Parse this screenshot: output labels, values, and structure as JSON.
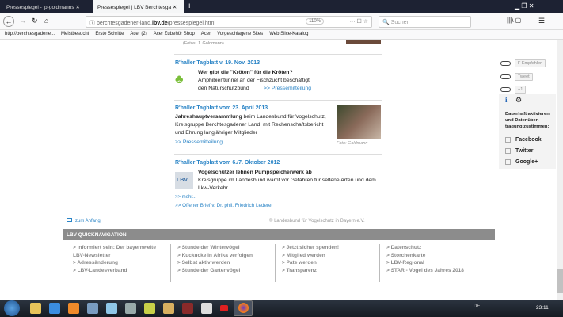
{
  "browser": {
    "tabs": [
      {
        "label": "Pressespiegel - jp-goldmanns"
      },
      {
        "label": "Pressespiegel | LBV Berchtesga"
      }
    ],
    "new_tab": "+",
    "url_domain": "berchtesgadener-land.",
    "url_bold": "lbv.de",
    "url_path": "/pressespiegel.html",
    "zoom": "110%",
    "search_placeholder": "Suchen",
    "bookmarks": [
      "http://berchtesgadene...",
      "Meistbesucht",
      "Erste Schritte",
      "Acer (2)",
      "Acer Zubehör Shop",
      "Acer",
      "Vorgeschlagene Sites",
      "Web Slice-Katalog"
    ]
  },
  "content": {
    "photo_credit_top": "(Fotos: J. Goldmann)",
    "articles": [
      {
        "source": "R'haller Tagblatt v. 19. Nov. 2013",
        "title": "Wer gibt die \"Kröten\" für die Kröten?",
        "text": "Amphibientunnel an der Fischzucht beschäftigt",
        "text2": "den Naturschutzbund",
        "link": ">> Pressemitteilung"
      },
      {
        "source": "R'haller Tagblatt vom 23. April 2013",
        "title": "Jahreshauptversammlung",
        "text": " beim Landesbund für Vogelschutz, Kreisgruppe Berchtesgadener Land, mit Rechenschaftsbericht und Ehrung langjähriger Mitglieder",
        "link": ">> Pressemitteilung",
        "photo_credit": "Foto: Goldmann"
      },
      {
        "source": "R'haller Tagblatt vom 6./7. Oktober 2012",
        "title": "Vogelschützer lehnen Pumpspeicherwerk ab",
        "text": "Kreisgruppe im Landesbund warnt vor Gefahren für seltene Arten und dem Lkw-Verkehr",
        "link": ">> mehr...",
        "link2": ">> Offener Brief v. Dr. phil. Friedrich Lederer",
        "logo": "LBV"
      }
    ],
    "to_top": "zum Anfang",
    "copyright": "© Landesbund für Vogelschutz in Bayern e.V."
  },
  "quicknav": {
    "title": "LBV QUICKNAVIGATION",
    "columns": [
      [
        ">  Informiert sein: Der bayernweite LBV-Newsletter",
        ">  Adressänderung",
        ">  LBV-Landesverband"
      ],
      [
        ">  Stunde der Wintervögel",
        ">  Kuckucke in Afrika verfolgen",
        ">  Selbst aktiv werden",
        ">  Stunde der Gartenvögel"
      ],
      [
        ">  Jetzt sicher spenden!",
        ">  Mitglied werden",
        ">  Pate werden",
        ">  Transparenz"
      ],
      [
        ">  Datenschutz",
        ">  Storchenkarte",
        ">  LBV-Regional",
        ">  STAR - Vogel des Jahres 2018"
      ]
    ]
  },
  "social": {
    "buttons": [
      "F  Empfehlen",
      "Tweet",
      "+1"
    ],
    "info": "i",
    "consent": "Dauerhaft aktivieren und Datenüber-tragung zustimmen:",
    "options": [
      "Facebook",
      "Twitter",
      "Google+"
    ]
  },
  "taskbar": {
    "lang": "DE",
    "time": "23:11"
  }
}
